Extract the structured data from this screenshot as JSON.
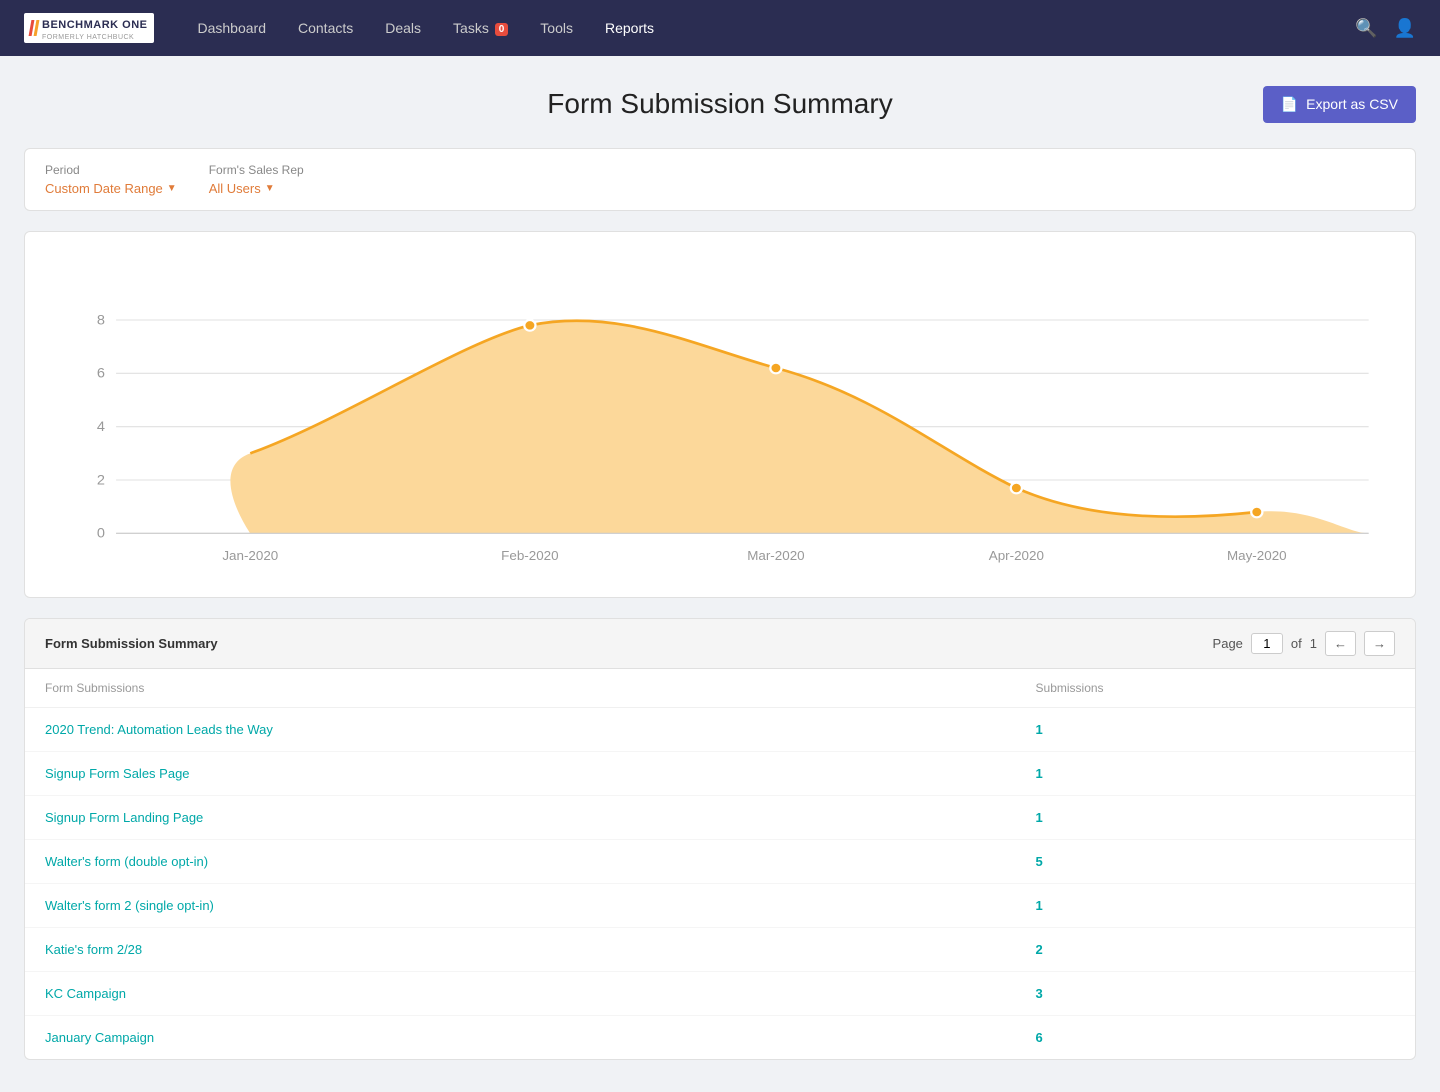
{
  "navbar": {
    "logo_text": "BENCHMARK ONE",
    "logo_sub": "FORMERLY HATCHBUCK",
    "links": [
      {
        "label": "Dashboard",
        "active": false,
        "badge": null
      },
      {
        "label": "Contacts",
        "active": false,
        "badge": null
      },
      {
        "label": "Deals",
        "active": false,
        "badge": null
      },
      {
        "label": "Tasks",
        "active": false,
        "badge": "0"
      },
      {
        "label": "Tools",
        "active": false,
        "badge": null
      },
      {
        "label": "Reports",
        "active": true,
        "badge": null
      }
    ]
  },
  "page": {
    "title": "Form Submission Summary",
    "export_button": "Export as CSV"
  },
  "filters": {
    "period_label": "Period",
    "period_value": "Custom Date Range",
    "sales_rep_label": "Form's Sales Rep",
    "sales_rep_value": "All Users"
  },
  "chart": {
    "y_labels": [
      "0",
      "2",
      "4",
      "6",
      "8"
    ],
    "x_labels": [
      "Jan-2020",
      "Feb-2020",
      "Mar-2020",
      "Apr-2020",
      "May-2020"
    ]
  },
  "table": {
    "title": "Form Submission Summary",
    "page_label": "Page",
    "page_current": "1",
    "page_total": "1",
    "of_label": "of",
    "col_form": "Form Submissions",
    "col_submissions": "Submissions",
    "rows": [
      {
        "form": "2020 Trend: Automation Leads the Way",
        "count": "1"
      },
      {
        "form": "Signup Form Sales Page",
        "count": "1"
      },
      {
        "form": "Signup Form Landing Page",
        "count": "1"
      },
      {
        "form": "Walter's form (double opt-in)",
        "count": "5"
      },
      {
        "form": "Walter's form 2 (single opt-in)",
        "count": "1"
      },
      {
        "form": "Katie's form 2/28",
        "count": "2"
      },
      {
        "form": "KC Campaign",
        "count": "3"
      },
      {
        "form": "January Campaign",
        "count": "6"
      }
    ]
  }
}
